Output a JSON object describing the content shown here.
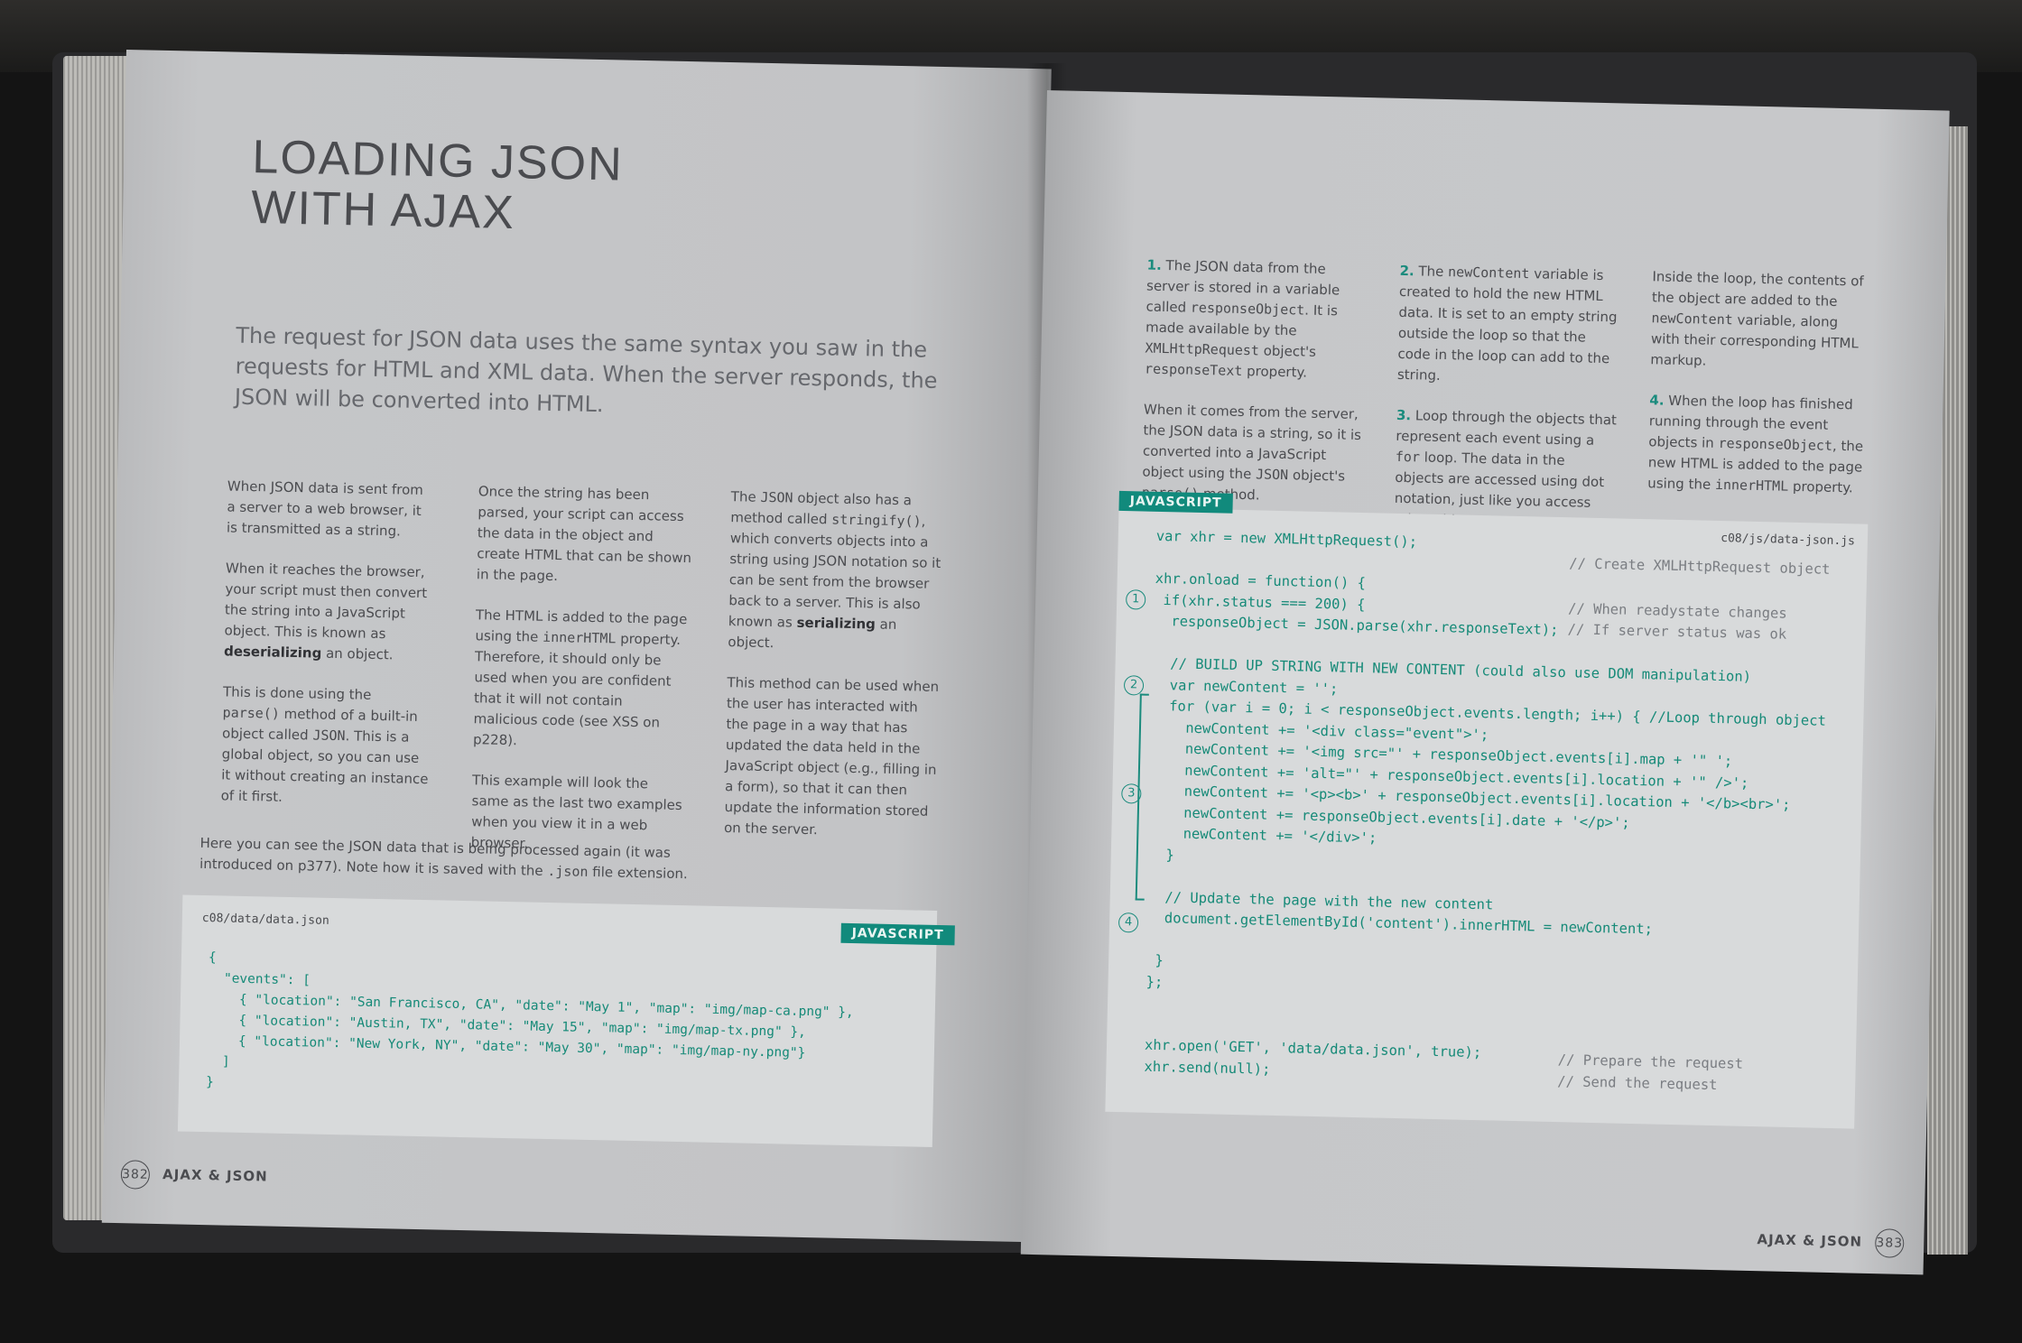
{
  "left": {
    "title_line1": "LOADING JSON",
    "title_line2": "WITH AJAX",
    "intro": "The request for JSON data uses the same syntax you saw in the requests for HTML and XML data. When the server responds, the JSON will be converted into HTML.",
    "col1": {
      "p1": "When JSON data is sent from a server to a web browser, it is transmitted as a string.",
      "p2_a": "When it reaches the browser, your script must then convert the string into a JavaScript object. This is known as ",
      "p2_b": "deserializing",
      "p2_c": " an object.",
      "p3_a": "This is done using the ",
      "p3_code": "parse()",
      "p3_b": " method of a built-in object called ",
      "p3_code2": "JSON",
      "p3_c": ". This is a global object, so you can use it without creating an instance of it first."
    },
    "col2": {
      "p1": "Once the string has been parsed, your script can access the data in the object and create HTML that can be shown in the page.",
      "p2_a": "The HTML is added to the page using the ",
      "p2_code": "innerHTML",
      "p2_b": " property. Therefore, it should only be used when you are confident that it will not contain malicious code (see XSS on p228).",
      "p3": "This example will look the same as the last two examples when you view it in a web browser."
    },
    "col3": {
      "p1_a": "The ",
      "p1_code": "JSON",
      "p1_b": " object also has a method called ",
      "p1_code2": "stringify()",
      "p1_c": ", which converts objects into a string using JSON notation so it can be sent from the browser back to a server. This is also known as ",
      "p1_bold": "serializing",
      "p1_d": " an object.",
      "p2": "This method can be used when the user has interacted with the page in a way that has updated the data held in the JavaScript object (e.g., filling in a form), so that it can then update the information stored on the server."
    },
    "note_a": "Here you can see the JSON data that is being processed again (it was introduced on p377). Note how it is saved with the ",
    "note_code": ".json",
    "note_b": " file extension.",
    "code_filename": "c08/data/data.json",
    "code_badge": "JAVASCRIPT",
    "code": "{\n  \"events\": [\n    { \"location\": \"San Francisco, CA\", \"date\": \"May 1\", \"map\": \"img/map-ca.png\" },\n    { \"location\": \"Austin, TX\", \"date\": \"May 15\", \"map\": \"img/map-tx.png\" },\n    { \"location\": \"New York, NY\", \"date\": \"May 30\", \"map\": \"img/map-ny.png\"}\n  ]\n}",
    "page_number": "382",
    "footer_label": "AJAX & JSON"
  },
  "right": {
    "s1_num": "1.",
    "s1_a": " The JSON data from the server is stored in a variable called ",
    "s1_code": "responseObject",
    "s1_b": ". It is made available by the ",
    "s1_code2": "XMLHttpRequest",
    "s1_c": " object's ",
    "s1_code3": "responseText",
    "s1_d": " property.",
    "s1b_a": "When it comes from the server, the JSON data is a string, so it is converted into a JavaScript object using the ",
    "s1b_code": "JSON",
    "s1b_b": " object's ",
    "s1b_code2": "parse()",
    "s1b_c": " method.",
    "s2_num": "2.",
    "s2_a": " The ",
    "s2_code": "newContent",
    "s2_b": " variable is created to hold the new HTML data. It is set to an empty string outside the loop so that the code in the loop can add to the string.",
    "s3_num": "3.",
    "s3_a": " Loop through the objects that represent each event using a ",
    "s3_code": "for",
    "s3_b": " loop. The data in the objects are accessed using dot notation, just like you access other objects.",
    "s3b_a": "Inside the loop, the contents of the object are added to the ",
    "s3b_code": "newContent",
    "s3b_b": " variable, along with their corresponding HTML markup.",
    "s4_num": "4.",
    "s4_a": " When the loop has finished running through the event objects in ",
    "s4_code": "responseObject",
    "s4_b": ", the new HTML is added to the page using the ",
    "s4_code2": "innerHTML",
    "s4_c": " property.",
    "code_badge": "JAVASCRIPT",
    "code_filename": "c08/js/data-json.js",
    "code_lines": [
      "var xhr = new XMLHttpRequest();",
      "",
      "xhr.onload = function() {",
      " if(xhr.status === 200) {",
      "  responseObject = JSON.parse(xhr.responseText);",
      "",
      "  // BUILD UP STRING WITH NEW CONTENT (could also use DOM manipulation)",
      "  var newContent = '';",
      "  for (var i = 0; i < responseObject.events.length; i++) { //Loop through object",
      "    newContent += '<div class=\"event\">';",
      "    newContent += '<img src=\"' + responseObject.events[i].map + '\" ';",
      "    newContent += 'alt=\"' + responseObject.events[i].location + '\" />';",
      "    newContent += '<p><b>' + responseObject.events[i].location + '</b><br>';",
      "    newContent += responseObject.events[i].date + '</p>';",
      "    newContent += '</div>';",
      "  }",
      "",
      "  // Update the page with the new content",
      "  document.getElementById('content').innerHTML = newContent;",
      "",
      " }",
      "};",
      "",
      "",
      "xhr.open('GET', 'data/data.json', true);",
      "xhr.send(null);"
    ],
    "comments": {
      "c1": "// Create XMLHttpRequest object",
      "c2": "// When readystate changes",
      "c3": "// If server status was ok",
      "c4": "// Prepare the request",
      "c5": "// Send the request"
    },
    "markers": [
      "1",
      "2",
      "3",
      "4"
    ],
    "page_number": "383",
    "footer_label": "AJAX & JSON"
  }
}
